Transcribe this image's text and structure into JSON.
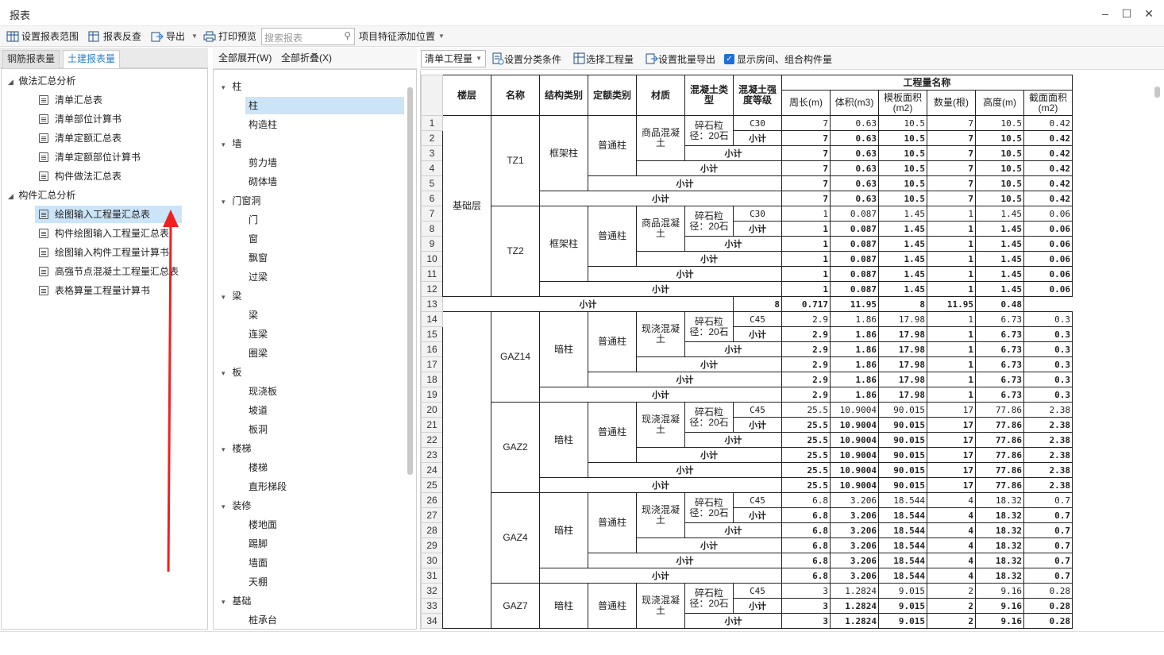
{
  "window": {
    "title": "报表",
    "minimize": "–",
    "maximize": "☐",
    "close": "✕"
  },
  "toolbar": {
    "set_range": "设置报表范围",
    "reverse_check": "报表反查",
    "export": "导出",
    "print_preview": "打印预览",
    "search_placeholder": "搜索报表",
    "feature_position": "项目特征添加位置"
  },
  "tabs": {
    "rebar": "钢筋报表量",
    "civil": "土建报表量"
  },
  "tree": {
    "groups": [
      {
        "label": "做法汇总分析",
        "items": [
          "清单汇总表",
          "清单部位计算书",
          "清单定额汇总表",
          "清单定额部位计算书",
          "构件做法汇总表"
        ]
      },
      {
        "label": "构件汇总分析",
        "items": [
          "绘图输入工程量汇总表",
          "构件绘图输入工程量汇总表",
          "绘图输入构件工程量计算书",
          "高强节点混凝土工程量汇总表",
          "表格算量工程量计算书"
        ]
      }
    ]
  },
  "mid": {
    "expand_all": "全部展开(W)",
    "collapse_all": "全部折叠(X)",
    "groups": [
      {
        "label": "柱",
        "items": [
          "柱",
          "构造柱"
        ]
      },
      {
        "label": "墙",
        "items": [
          "剪力墙",
          "砌体墙"
        ]
      },
      {
        "label": "门窗洞",
        "items": [
          "门",
          "窗",
          "飘窗",
          "过梁"
        ]
      },
      {
        "label": "梁",
        "items": [
          "梁",
          "连梁",
          "圈梁"
        ]
      },
      {
        "label": "板",
        "items": [
          "现浇板",
          "坡道",
          "板洞"
        ]
      },
      {
        "label": "楼梯",
        "items": [
          "楼梯",
          "直形梯段"
        ]
      },
      {
        "label": "装修",
        "items": [
          "楼地面",
          "踢脚",
          "墙面",
          "天棚"
        ]
      },
      {
        "label": "基础",
        "items": [
          "桩承台"
        ]
      }
    ]
  },
  "right_toolbar": {
    "combo": "清单工程量",
    "classify": "设置分类条件",
    "choose": "选择工程量",
    "batch_export": "设置批量导出",
    "show_rooms": "显示房间、组合构件量"
  },
  "table": {
    "headers": {
      "floor": "楼层",
      "name": "名称",
      "struct": "结构类别",
      "quota": "定额类别",
      "material": "材质",
      "concrete_type": "混凝土类型",
      "grade": "混凝土强度等级",
      "qty_group": "工程量名称",
      "perimeter": "周长(m)",
      "volume": "体积(m3)",
      "formwork": "模板面积(m2)",
      "count": "数量(根)",
      "height": "高度(m)",
      "section": "截面面积(m2)"
    },
    "subtotal": "小计",
    "floor_name": "基础层",
    "blocks": [
      {
        "name": "TZ1",
        "struct": "框架柱",
        "quota": "普通柱",
        "material": "商品混凝土",
        "ctype": "碎石粒径：20石",
        "grade": "C30",
        "vals": [
          "7",
          "0.63",
          "10.5",
          "7",
          "10.5",
          "0.42"
        ]
      },
      {
        "name": "TZ2",
        "struct": "框架柱",
        "quota": "普通柱",
        "material": "商品混凝土",
        "ctype": "碎石粒径：20石",
        "grade": "C30",
        "vals": [
          "1",
          "0.087",
          "1.45",
          "1",
          "1.45",
          "0.06"
        ]
      },
      {
        "floor_subtotal": [
          "8",
          "0.717",
          "11.95",
          "8",
          "11.95",
          "0.48"
        ]
      },
      {
        "name": "GAZ14",
        "struct": "暗柱",
        "quota": "普通柱",
        "material": "现浇混凝土",
        "ctype": "碎石粒径：20石",
        "grade": "C45",
        "vals": [
          "2.9",
          "1.86",
          "17.98",
          "1",
          "6.73",
          "0.3"
        ]
      },
      {
        "name": "GAZ2",
        "struct": "暗柱",
        "quota": "普通柱",
        "material": "现浇混凝土",
        "ctype": "碎石粒径：20石",
        "grade": "C45",
        "vals": [
          "25.5",
          "10.9004",
          "90.015",
          "17",
          "77.86",
          "2.38"
        ]
      },
      {
        "name": "GAZ4",
        "struct": "暗柱",
        "quota": "普通柱",
        "material": "现浇混凝土",
        "ctype": "碎石粒径：20石",
        "grade": "C45",
        "vals": [
          "6.8",
          "3.206",
          "18.544",
          "4",
          "18.32",
          "0.7"
        ]
      },
      {
        "name": "GAZ7",
        "struct": "暗柱",
        "quota": "普通柱",
        "material": "现浇混凝土",
        "ctype": "碎石粒径：20石",
        "grade": "C45",
        "vals": [
          "3",
          "1.2824",
          "9.015",
          "2",
          "9.16",
          "0.28"
        ],
        "partial": true
      }
    ]
  }
}
